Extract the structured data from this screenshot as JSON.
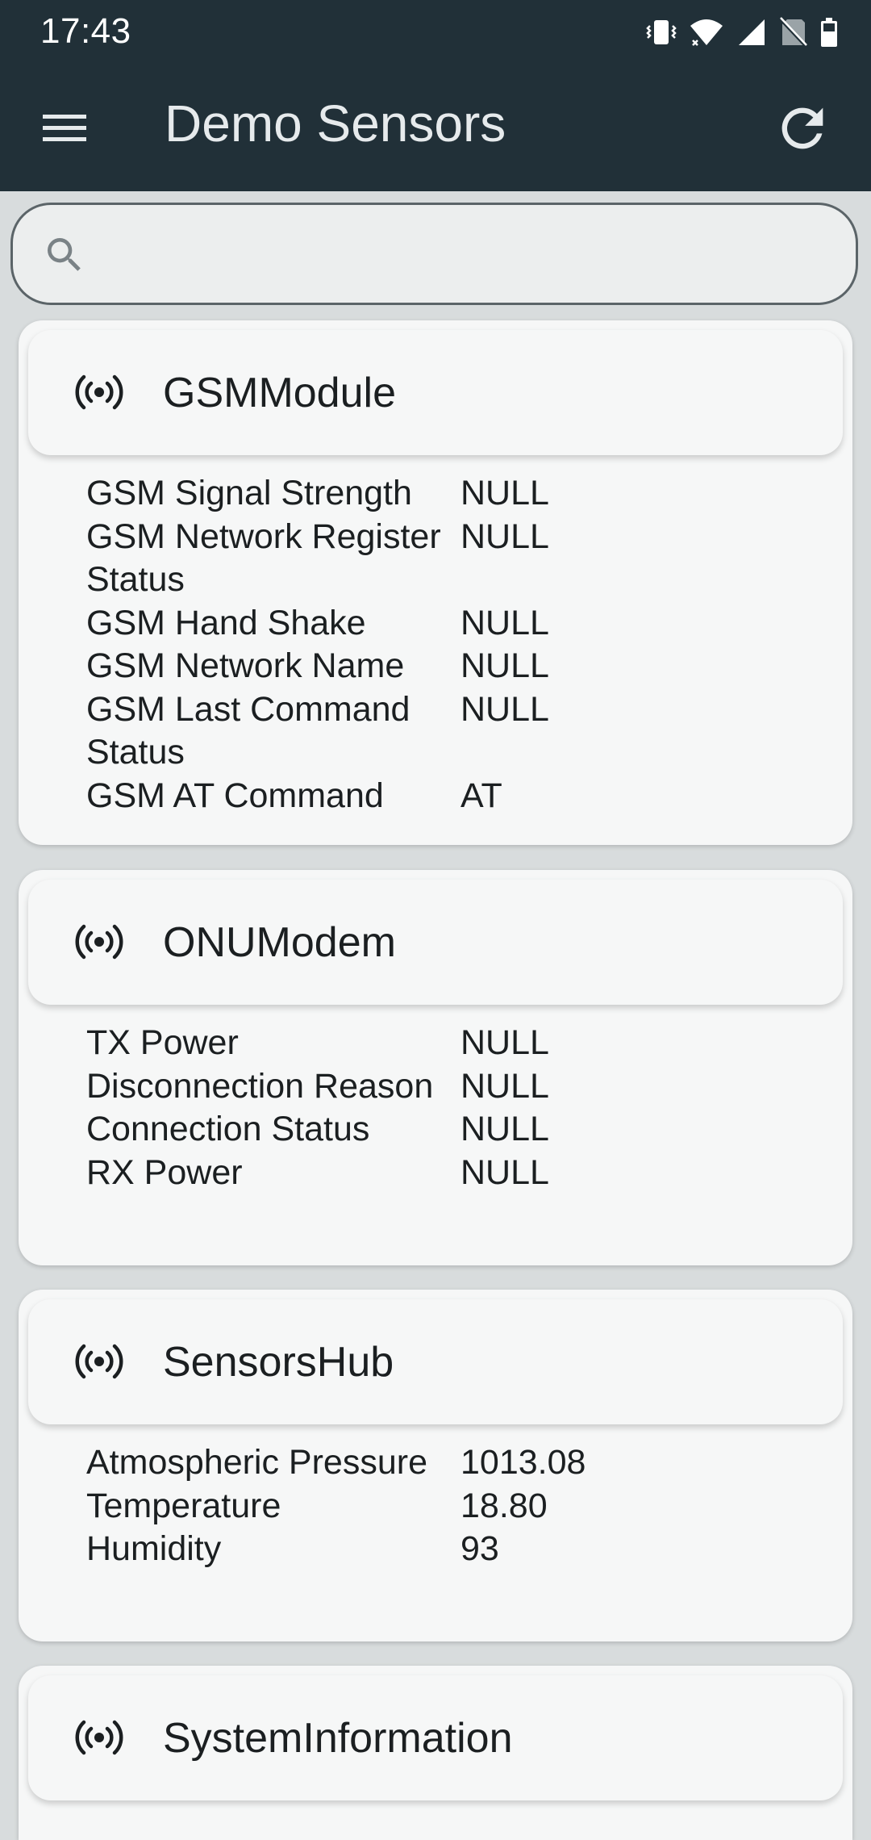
{
  "status_bar": {
    "time": "17:43",
    "icons": [
      "vibrate-icon",
      "wifi-icon",
      "cell-signal-icon",
      "no-sim-icon",
      "battery-icon"
    ]
  },
  "app_bar": {
    "title": "Demo Sensors",
    "menu_icon": "menu-icon",
    "refresh_icon": "refresh-icon",
    "background": "#213038"
  },
  "search": {
    "placeholder": "",
    "value": "",
    "icon": "search-icon"
  },
  "cards": [
    {
      "title": "GSMModule",
      "icon": "sensor-broadcast-icon",
      "rows": [
        {
          "label": "GSM Signal Strength",
          "value": "NULL"
        },
        {
          "label": "GSM Network Register Status",
          "value": "NULL"
        },
        {
          "label": "GSM Hand Shake",
          "value": "NULL"
        },
        {
          "label": "GSM Network Name",
          "value": "NULL"
        },
        {
          "label": "GSM Last Command Status",
          "value": "NULL"
        },
        {
          "label": "GSM AT Command",
          "value": "AT"
        }
      ]
    },
    {
      "title": "ONUModem",
      "icon": "sensor-broadcast-icon",
      "rows": [
        {
          "label": "TX Power",
          "value": "NULL"
        },
        {
          "label": "Disconnection Reason",
          "value": "NULL"
        },
        {
          "label": "Connection Status",
          "value": "NULL"
        },
        {
          "label": "RX Power",
          "value": "NULL"
        }
      ]
    },
    {
      "title": "SensorsHub",
      "icon": "sensor-broadcast-icon",
      "rows": [
        {
          "label": "Atmospheric Pressure",
          "value": "1013.08"
        },
        {
          "label": "Temperature",
          "value": "18.80"
        },
        {
          "label": "Humidity",
          "value": "93"
        }
      ]
    },
    {
      "title": "SystemInformation",
      "icon": "sensor-broadcast-icon",
      "rows": []
    }
  ]
}
